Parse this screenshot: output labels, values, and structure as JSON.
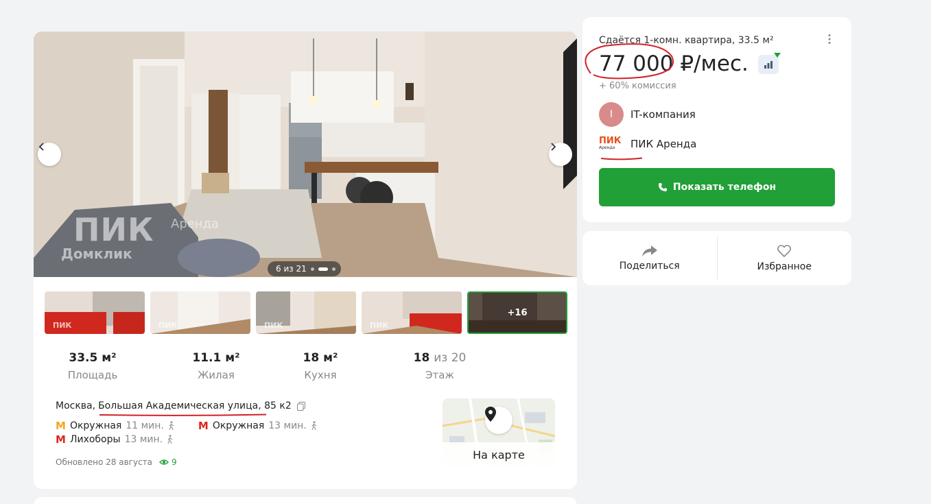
{
  "gallery": {
    "counter": "6 из 21",
    "watermark_brand": "ПИК",
    "watermark_sub": "Аренда",
    "watermark_domclick": "Домклик",
    "prev_icon": "chevron-left-icon",
    "next_icon": "chevron-right-icon"
  },
  "thumbnails": {
    "watermark": "ПИК",
    "more_label": "+16"
  },
  "facts": [
    {
      "value": "33.5 м²",
      "label": "Площадь"
    },
    {
      "value": "11.1 м²",
      "label": "Жилая"
    },
    {
      "value": "18 м²",
      "label": "Кухня"
    },
    {
      "value": "18",
      "suffix": "из 20",
      "label": "Этаж"
    }
  ],
  "address": {
    "city": "Москва,",
    "street": "Большая Академическая улица, 85 к2"
  },
  "metro": [
    {
      "station": "Окружная",
      "time": "11 мин.",
      "color": "#f5a623"
    },
    {
      "station": "Окружная",
      "time": "13 мин.",
      "color": "#e0251b"
    },
    {
      "station": "Лихоборы",
      "time": "13 мин.",
      "color": "#e0251b"
    }
  ],
  "updated": {
    "text": "Обновлено 28 августа",
    "views": "9"
  },
  "map": {
    "label": "На карте"
  },
  "listing": {
    "title": "Сдаётся 1-комн. квартира, 33.5 м²",
    "price": "77 000 ₽/мес.",
    "commission": "+ 60% комиссия"
  },
  "sellers": {
    "company": {
      "avatar_letter": "I",
      "name": "IT-компания"
    },
    "agency": {
      "logo_text": "ПИК",
      "logo_sub": "Аренда",
      "name": "ПИК Аренда"
    }
  },
  "buttons": {
    "show_phone": "Показать телефон",
    "share": "Поделиться",
    "favorite": "Избранное"
  },
  "colors": {
    "accent_green": "#21a038",
    "annotation_red": "#d0202a",
    "metro_orange": "#f5a623",
    "metro_red": "#e0251b"
  }
}
